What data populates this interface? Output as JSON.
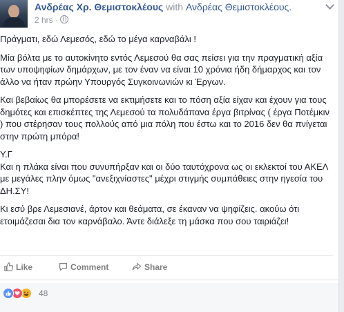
{
  "post": {
    "author_name": "Ανδρέας Χρ. Θεμιστοκλέους",
    "with_text": "with",
    "tagged_name": "Ανδρέας Θεμιστοκλέους.",
    "time": "2 hrs ·",
    "privacy_icon": "globe-icon",
    "paragraphs": [
      "Πράγματι, εδώ Λεμεσός, εδώ το μέγα καρναβάλι !",
      "Μία βόλτα με το αυτοκίνητο εντός Λεμεσού θα σας πείσει για την πραγματική αξία των υποψηφίων δημάρχων, με τον έναν να είναι 10 χρόνια ήδη δήμαρχος και τον άλλο να ήταν πρώην Υπουργός Συγκοινωνιών κι Έργων.",
      "Και βεβαίως θα μπορέσετε να εκτιμήσετε και το πόση αξία είχαν και έχουν για τους δημότες και επισκέπτες της Λεμεσού τα πολυδάπανα έργα βιτρίνας ( έργα Ποτέμκιν ) που στέρησαν τους πολλούς από μια πόλη που έστω και το 2016 δεν θα πνίγεται στην πρώτη μπόρα!",
      "Υ.Γ\nΚαι η πλάκα είναι που συνυπήρξαν και οι δύο ταυτόχρονα ως οι εκλεκτοί του ΑΚΕΛ με μεγάλες πλην όμως \"ανεξιχνίαστες\" μέχρι στιγμής συμπάθειες στην ηγεσία του ΔΗ.ΣΥ!",
      "Κι εσύ βρε Λεμεσιανέ, άρτον και θεάματα, σε έκαναν να ψηφίζεις. ακούω ότι ετοιμάζεσαι δια τον καρνάβαλο. Άντε διάλεξε τη μάσκα που σου ταιριάζει!"
    ]
  },
  "actions": {
    "like": "Like",
    "comment": "Comment",
    "share": "Share"
  },
  "reactions": {
    "icons": [
      "like-reaction-icon",
      "love-reaction-icon",
      "haha-reaction-icon"
    ],
    "count": "48"
  },
  "colors": {
    "link": "#365899",
    "muted": "#90949c",
    "like_blue": "#5890ff",
    "love_red": "#f25268",
    "haha_yellow": "#f7b125"
  }
}
